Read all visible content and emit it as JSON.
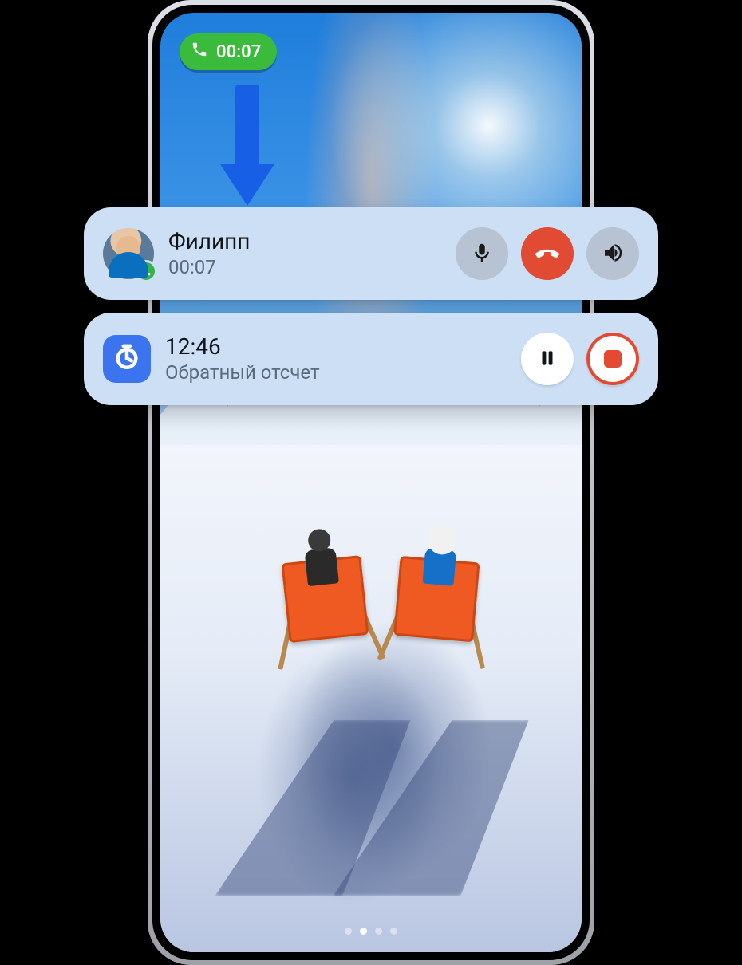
{
  "status_bar": {
    "call_pill_time": "00:07"
  },
  "arrow": {
    "color": "#1760e6"
  },
  "call_card": {
    "name": "Филипп",
    "duration": "00:07",
    "buttons": {
      "mute_icon": "microphone-icon",
      "hangup_icon": "hangup-icon",
      "speaker_icon": "speaker-icon"
    }
  },
  "timer_card": {
    "time": "12:46",
    "label": "Обратный отсчет",
    "buttons": {
      "pause_icon": "pause-icon",
      "stop_icon": "stop-icon"
    }
  },
  "pager": {
    "count": 4,
    "active_index": 1
  },
  "colors": {
    "card_bg": "#cddff4",
    "accent_red": "#e14a33",
    "accent_blue": "#3c73ee",
    "status_green": "#3bbb3b"
  }
}
